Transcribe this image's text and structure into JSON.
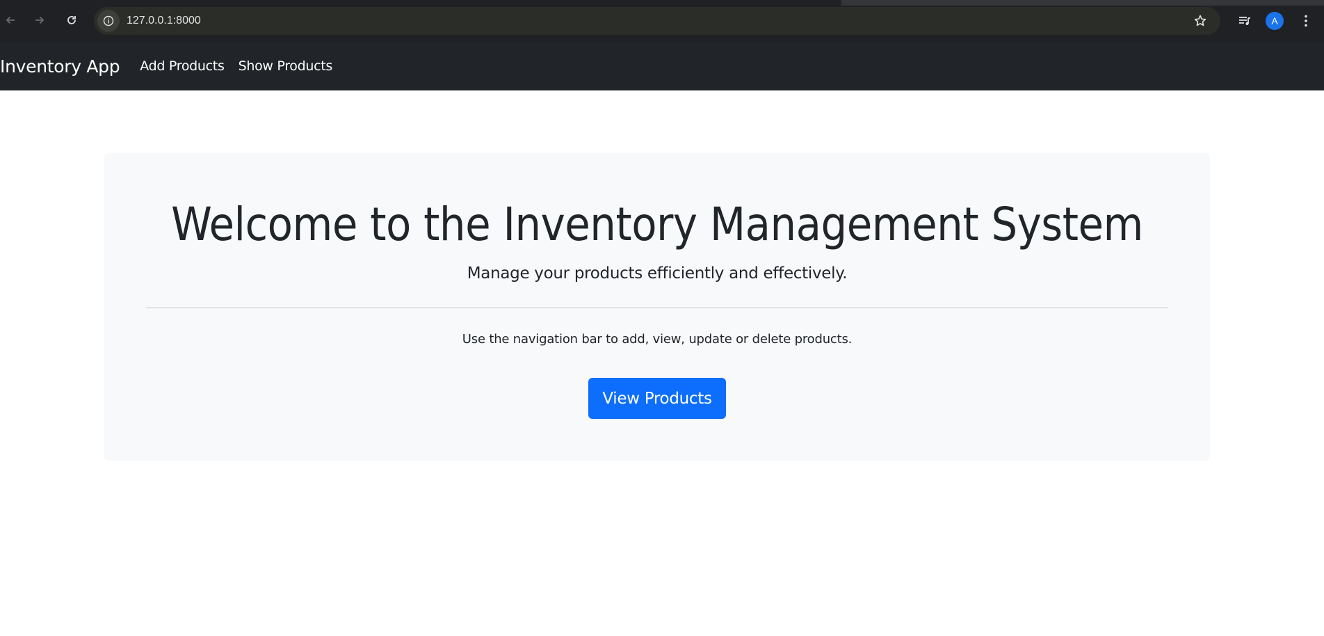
{
  "browser": {
    "url": "127.0.0.1:8000",
    "avatar_letter": "A",
    "icons": [
      "back-arrow-icon",
      "forward-arrow-icon",
      "reload-icon",
      "site-info-icon",
      "bookmark-star-icon",
      "media-queue-icon",
      "more-vert-icon"
    ]
  },
  "navbar": {
    "brand": "Inventory App",
    "links": [
      {
        "label": "Add Products"
      },
      {
        "label": "Show Products"
      }
    ]
  },
  "hero": {
    "title": "Welcome to the Inventory Management System",
    "lead": "Manage your products efficiently and effectively.",
    "body": "Use the navigation bar to add, view, update or delete products.",
    "button_label": "View Products"
  },
  "colors": {
    "navbar_bg": "#212529",
    "hero_bg": "#f8f9fa",
    "primary_button": "#0d6efd",
    "browser_chrome": "#202124"
  }
}
